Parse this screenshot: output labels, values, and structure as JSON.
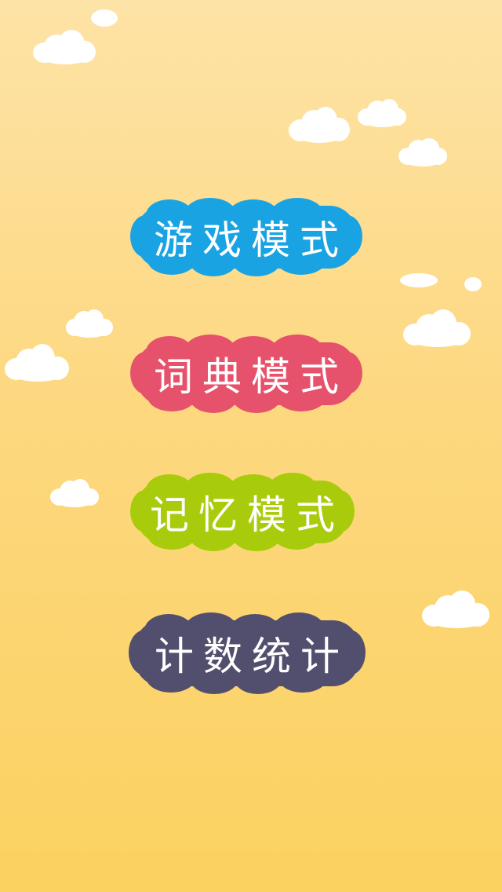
{
  "background": {
    "gradient_top": "#fde3a6",
    "gradient_bottom": "#fbd160"
  },
  "menu": {
    "items": [
      {
        "label": "游戏模式",
        "color": "#1aa3e3"
      },
      {
        "label": "词典模式",
        "color": "#e6526c"
      },
      {
        "label": "记忆模式",
        "color": "#a8cc0b"
      },
      {
        "label": "计数统计",
        "color": "#524f6e"
      }
    ]
  }
}
